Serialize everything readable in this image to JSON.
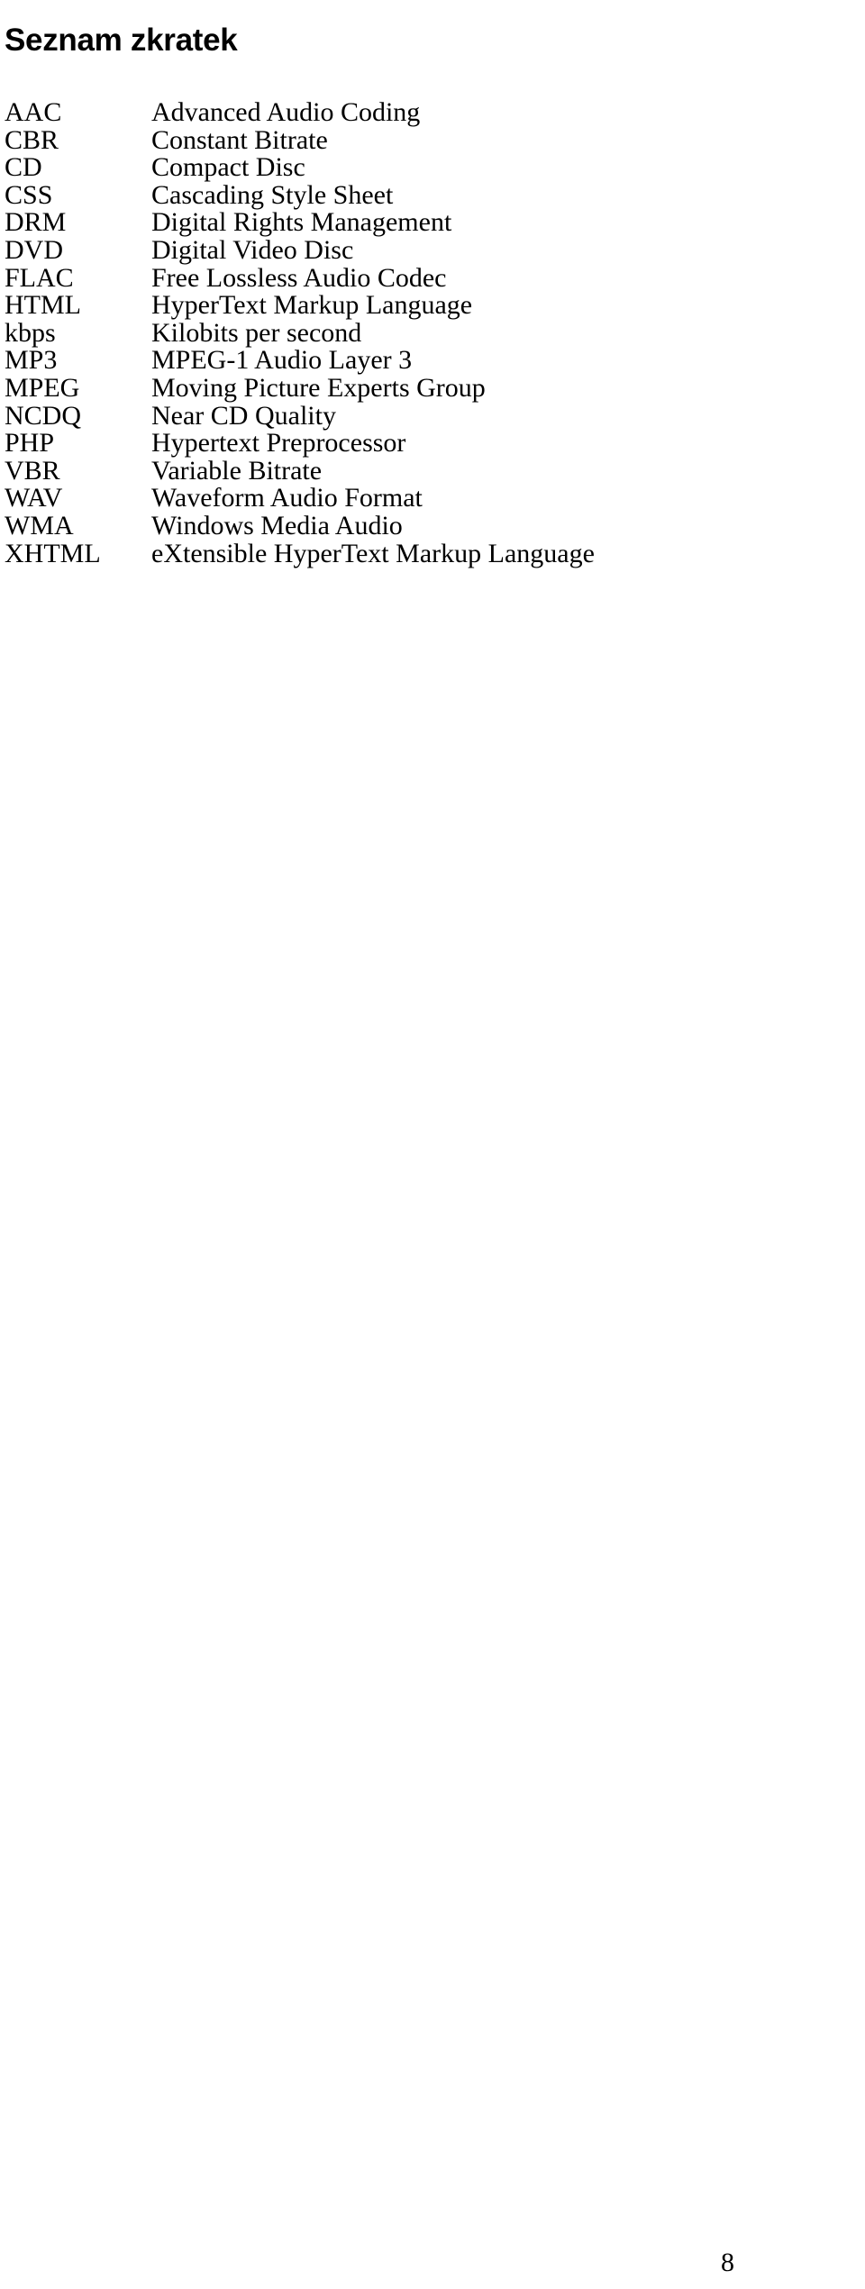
{
  "document": {
    "title": "Seznam zkratek",
    "page_number": "8",
    "text_color": "#000000",
    "background_color": "#ffffff"
  },
  "abbreviations": [
    {
      "term": "AAC",
      "description": "Advanced Audio Coding"
    },
    {
      "term": "CBR",
      "description": "Constant Bitrate"
    },
    {
      "term": "CD",
      "description": "Compact Disc"
    },
    {
      "term": "CSS",
      "description": "Cascading Style Sheet"
    },
    {
      "term": "DRM",
      "description": "Digital Rights Management"
    },
    {
      "term": "DVD",
      "description": "Digital Video Disc"
    },
    {
      "term": "FLAC",
      "description": "Free Lossless Audio Codec"
    },
    {
      "term": "HTML",
      "description": "HyperText Markup Language"
    },
    {
      "term": "kbps",
      "description": "Kilobits per second"
    },
    {
      "term": "MP3",
      "description": "MPEG-1 Audio Layer 3"
    },
    {
      "term": "MPEG",
      "description": "Moving Picture Experts Group"
    },
    {
      "term": "NCDQ",
      "description": "Near CD Quality"
    },
    {
      "term": "PHP",
      "description": "Hypertext Preprocessor"
    },
    {
      "term": "VBR",
      "description": "Variable Bitrate"
    },
    {
      "term": "WAV",
      "description": "Waveform Audio Format"
    },
    {
      "term": "WMA",
      "description": "Windows Media Audio"
    },
    {
      "term": "XHTML",
      "description": "eXtensible HyperText Markup Language"
    }
  ]
}
